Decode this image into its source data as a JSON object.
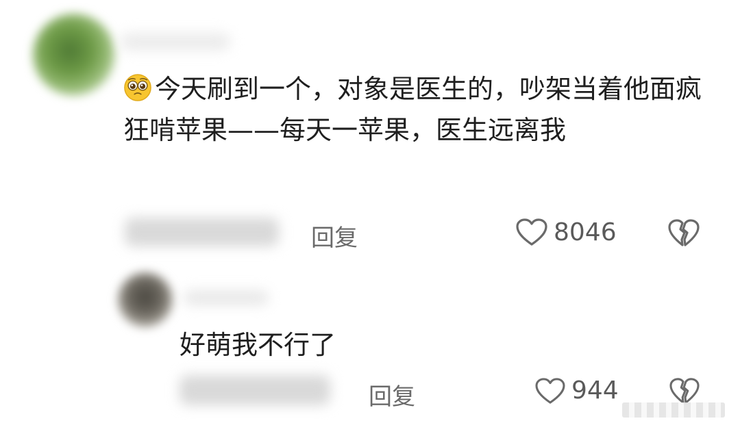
{
  "comments": [
    {
      "emoji": "pleading-face-emoji",
      "text": "今天刷到一个，对象是医生的，吵架当着他面疯狂啃苹果——每天一苹果，医生远离我",
      "reply_label": "回复",
      "like_count": "8046"
    },
    {
      "text": "好萌我不行了",
      "reply_label": "回复",
      "like_count": "944"
    }
  ]
}
